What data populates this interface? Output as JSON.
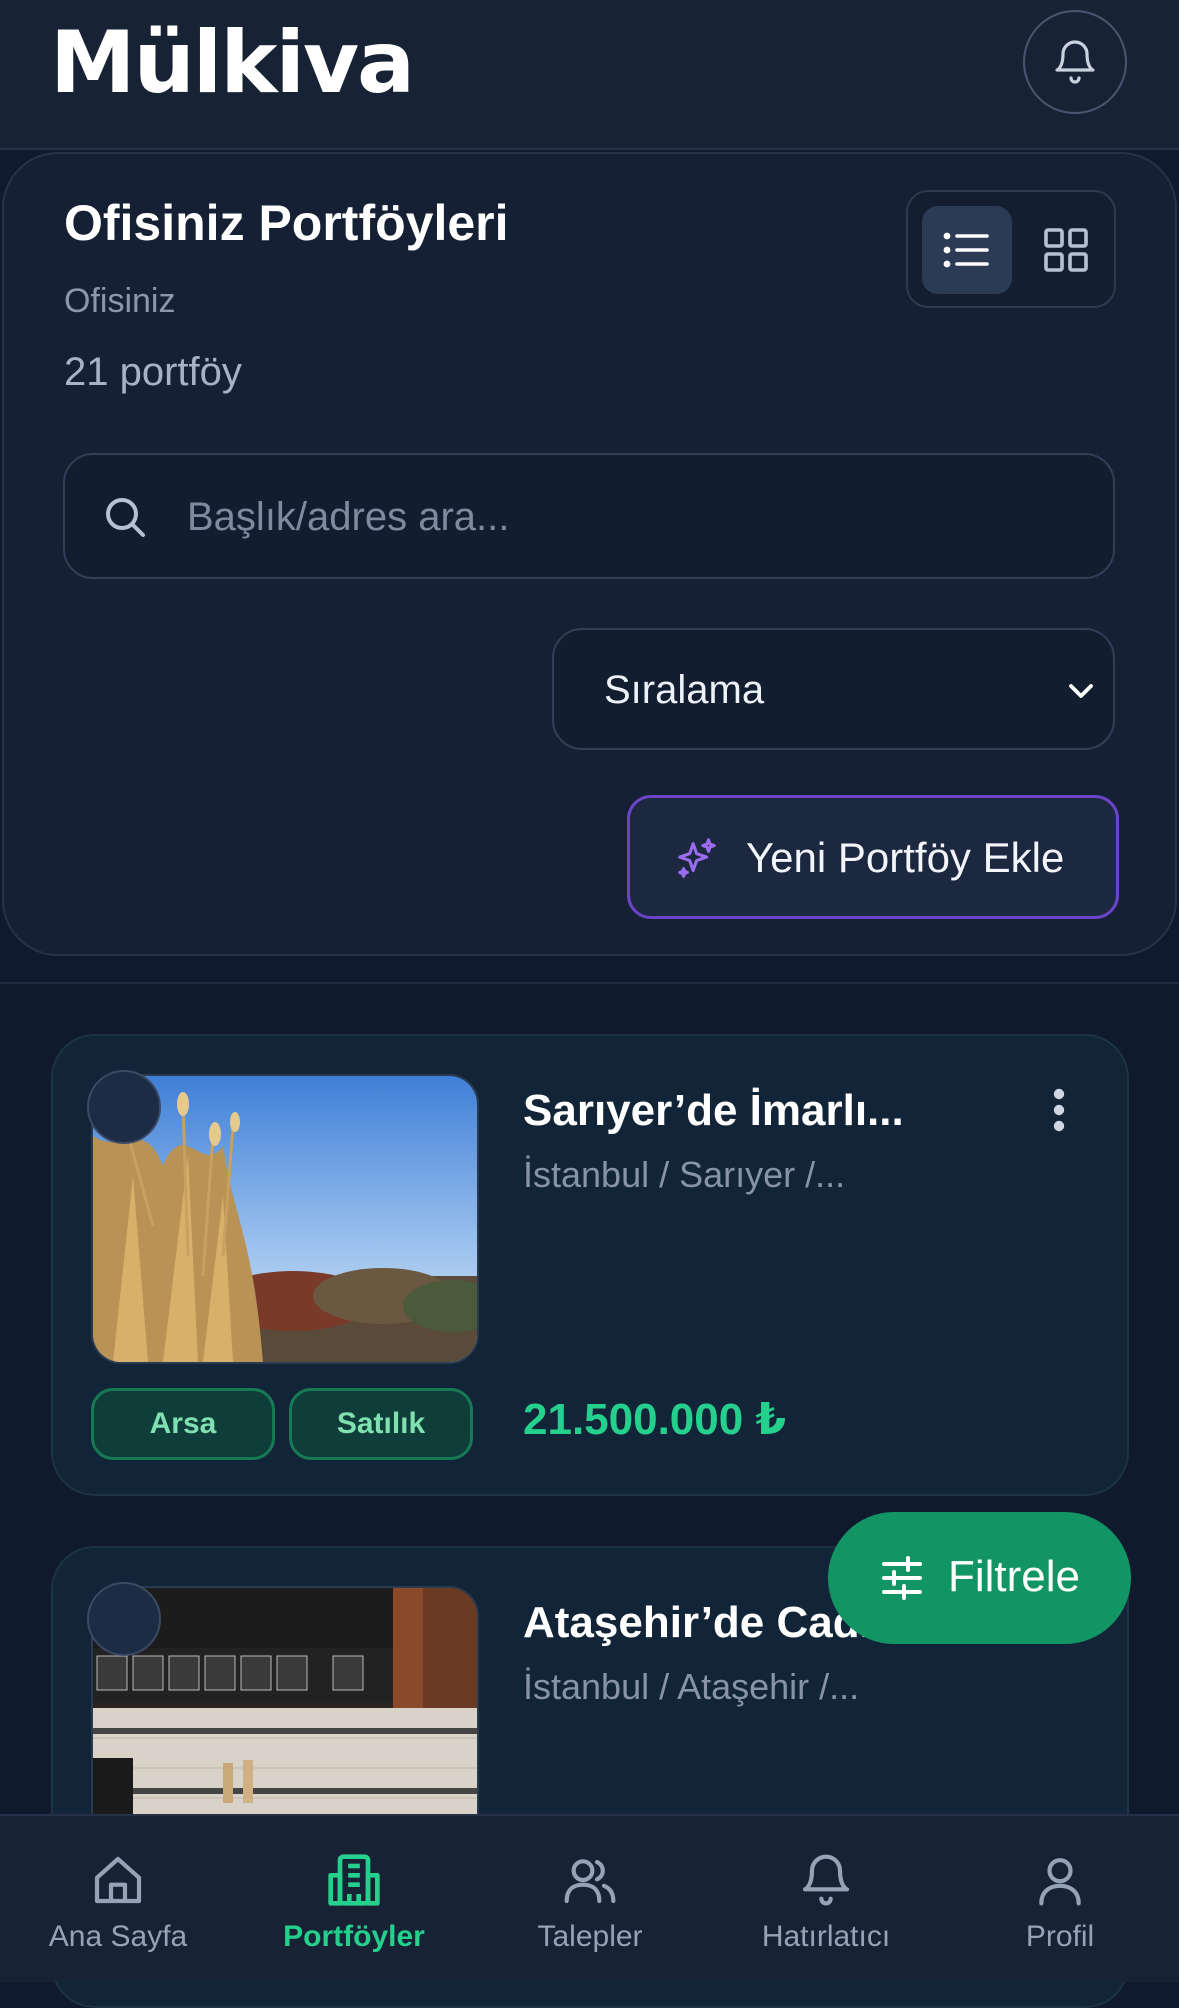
{
  "header": {
    "logo": "Mülkiva",
    "notifications_icon": "bell-icon"
  },
  "panel": {
    "title": "Ofisiniz Portföyleri",
    "subtitle": "Ofisiniz",
    "count": "21 portföy",
    "view_mode": "list",
    "search": {
      "placeholder": "Başlık/adres ara...",
      "value": ""
    },
    "sort": {
      "label": "Sıralama"
    },
    "add_button": "Yeni Portföy Ekle"
  },
  "listings": [
    {
      "title": "Sarıyer’de İmarlı...",
      "location": "İstanbul / Sarıyer /...",
      "tags": [
        "Arsa",
        "Satılık"
      ],
      "price": "21.500.000 ₺",
      "image": "field-with-reeds"
    },
    {
      "title": "Ataşehir’de Cad...",
      "location": "İstanbul / Ataşehir /...",
      "tags": [],
      "price": "",
      "image": "cafe-interior"
    }
  ],
  "filter_button": "Filtrele",
  "bottom_nav": [
    {
      "label": "Ana Sayfa",
      "icon": "home-icon",
      "active": false
    },
    {
      "label": "Portföyler",
      "icon": "building-icon",
      "active": true
    },
    {
      "label": "Talepler",
      "icon": "users-icon",
      "active": false
    },
    {
      "label": "Hatırlatıcı",
      "icon": "bell-icon",
      "active": false
    },
    {
      "label": "Profil",
      "icon": "user-icon",
      "active": false
    }
  ],
  "colors": {
    "accent_green": "#25d08c",
    "filter_button": "#129564",
    "add_button_border": "#6c44c9",
    "background": "#101a2e"
  }
}
